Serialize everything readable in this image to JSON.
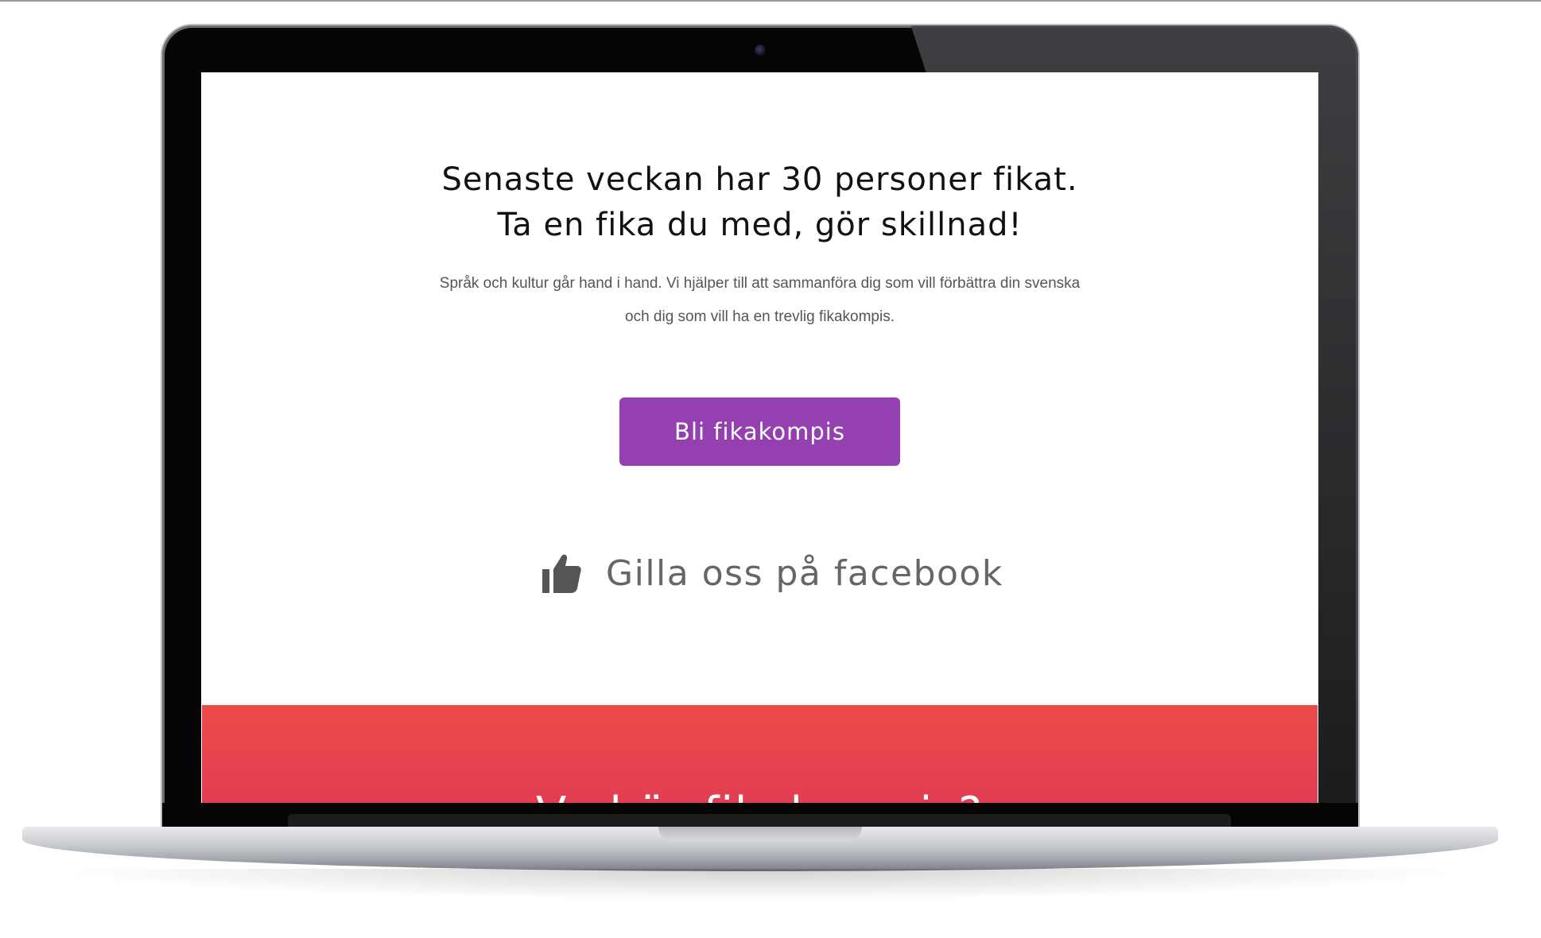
{
  "hero": {
    "headline_line1": "Senaste veckan har 30 personer fikat.",
    "headline_line2": "Ta en fika du med, gör skillnad!",
    "subtext_line1": "Språk och kultur går hand i hand. Vi hjälper till att sammanföra dig som vill förbättra din svenska",
    "subtext_line2": "och dig som vill ha en trevlig fikakompis."
  },
  "cta": {
    "label": "Bli fikakompis",
    "color": "#9440b0"
  },
  "facebook": {
    "icon": "thumbs-up-icon",
    "label": "Gilla oss på facebook"
  },
  "next_section": {
    "title": "Vad är fikakompis?",
    "color": "#e8444e"
  }
}
